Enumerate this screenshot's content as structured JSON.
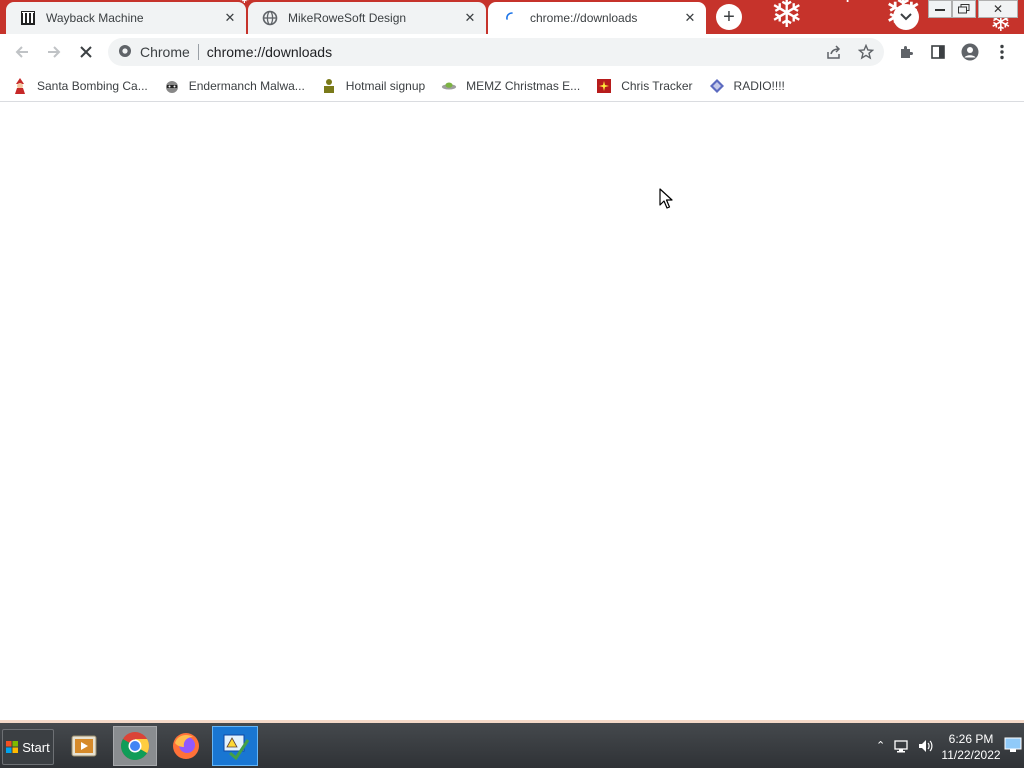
{
  "tabs": [
    {
      "title": "Wayback Machine",
      "favicon": "wayback-icon",
      "active": false
    },
    {
      "title": "MikeRoweSoft Design",
      "favicon": "globe-icon",
      "active": false
    },
    {
      "title": "chrome://downloads",
      "favicon": "loading-spinner-icon",
      "active": true
    }
  ],
  "toolbar": {
    "site_label": "Chrome",
    "url": "chrome://downloads"
  },
  "bookmarks": [
    {
      "label": "Santa Bombing Ca...",
      "icon": "santa-icon"
    },
    {
      "label": "Endermanch Malwa...",
      "icon": "raccoon-icon"
    },
    {
      "label": "Hotmail signup",
      "icon": "person-icon"
    },
    {
      "label": "MEMZ Christmas E...",
      "icon": "ufo-icon"
    },
    {
      "label": "Chris Tracker",
      "icon": "red-card-icon"
    },
    {
      "label": "RADIO!!!!",
      "icon": "diamond-icon"
    }
  ],
  "taskbar": {
    "start_label": "Start",
    "time": "6:26 PM",
    "date": "11/22/2022"
  },
  "colors": {
    "tabstrip": "#c6332b",
    "tab_inactive": "#f1f3f4",
    "omnibox": "#f1f3f4",
    "taskbar": "#3a3d41"
  }
}
